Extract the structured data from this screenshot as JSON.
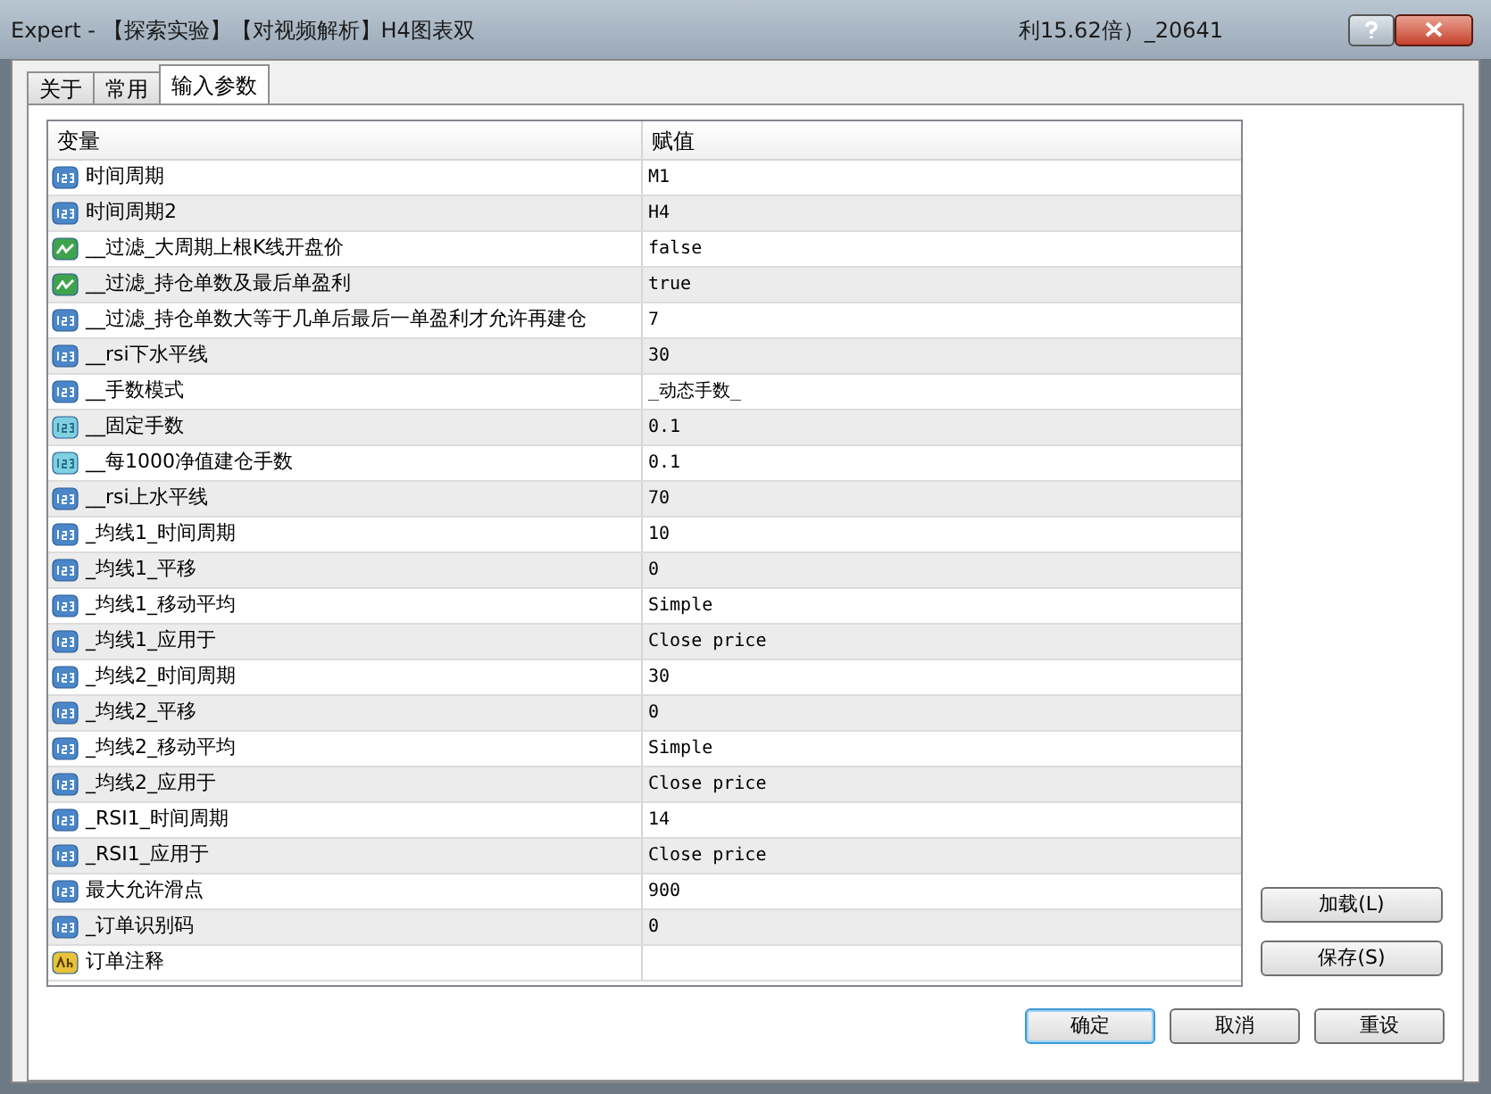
{
  "window": {
    "title_parts": [
      "Expert - 【探索实验】【对视频解析】H4图表双",
      "利15.62倍）_20641"
    ]
  },
  "tabs": [
    {
      "label": "关于",
      "selected": false
    },
    {
      "label": "常用",
      "selected": false
    },
    {
      "label": "输入参数",
      "selected": true
    }
  ],
  "table": {
    "columns": [
      "变量",
      "赋值"
    ],
    "rows": [
      {
        "kind": "int",
        "name": "时间周期",
        "value": "M1"
      },
      {
        "kind": "int",
        "name": "时间周期2",
        "value": "H4"
      },
      {
        "kind": "bool",
        "name": "__过滤_大周期上根K线开盘价",
        "value": "false"
      },
      {
        "kind": "bool",
        "name": "__过滤_持仓单数及最后单盈利",
        "value": "true"
      },
      {
        "kind": "int",
        "name": "__过滤_持仓单数大等于几单后最后一单盈利才允许再建仓",
        "value": "7"
      },
      {
        "kind": "int",
        "name": "__rsi下水平线",
        "value": "30"
      },
      {
        "kind": "int",
        "name": "__手数模式",
        "value": "_动态手数_"
      },
      {
        "kind": "double",
        "name": "__固定手数",
        "value": "0.1"
      },
      {
        "kind": "double",
        "name": "__每1000净值建仓手数",
        "value": "0.1"
      },
      {
        "kind": "int",
        "name": "__rsi上水平线",
        "value": "70"
      },
      {
        "kind": "int",
        "name": "_均线1_时间周期",
        "value": "10"
      },
      {
        "kind": "int",
        "name": "_均线1_平移",
        "value": "0"
      },
      {
        "kind": "int",
        "name": "_均线1_移动平均",
        "value": "Simple"
      },
      {
        "kind": "int",
        "name": "_均线1_应用于",
        "value": "Close price"
      },
      {
        "kind": "int",
        "name": "_均线2_时间周期",
        "value": "30"
      },
      {
        "kind": "int",
        "name": "_均线2_平移",
        "value": "0"
      },
      {
        "kind": "int",
        "name": "_均线2_移动平均",
        "value": "Simple"
      },
      {
        "kind": "int",
        "name": "_均线2_应用于",
        "value": "Close price"
      },
      {
        "kind": "int",
        "name": "_RSI1_时间周期",
        "value": "14"
      },
      {
        "kind": "int",
        "name": "_RSI1_应用于",
        "value": "Close price"
      },
      {
        "kind": "int",
        "name": "最大允许滑点",
        "value": "900"
      },
      {
        "kind": "int",
        "name": "_订单识别码",
        "value": "0"
      },
      {
        "kind": "string",
        "name": "订单注释"
      }
    ]
  },
  "side_buttons": [
    "加载(L)",
    "保存(S)"
  ],
  "dialog_buttons": [
    {
      "label": "确定",
      "default": true
    },
    {
      "label": "取消",
      "default": false
    },
    {
      "label": "重设",
      "default": false
    }
  ]
}
